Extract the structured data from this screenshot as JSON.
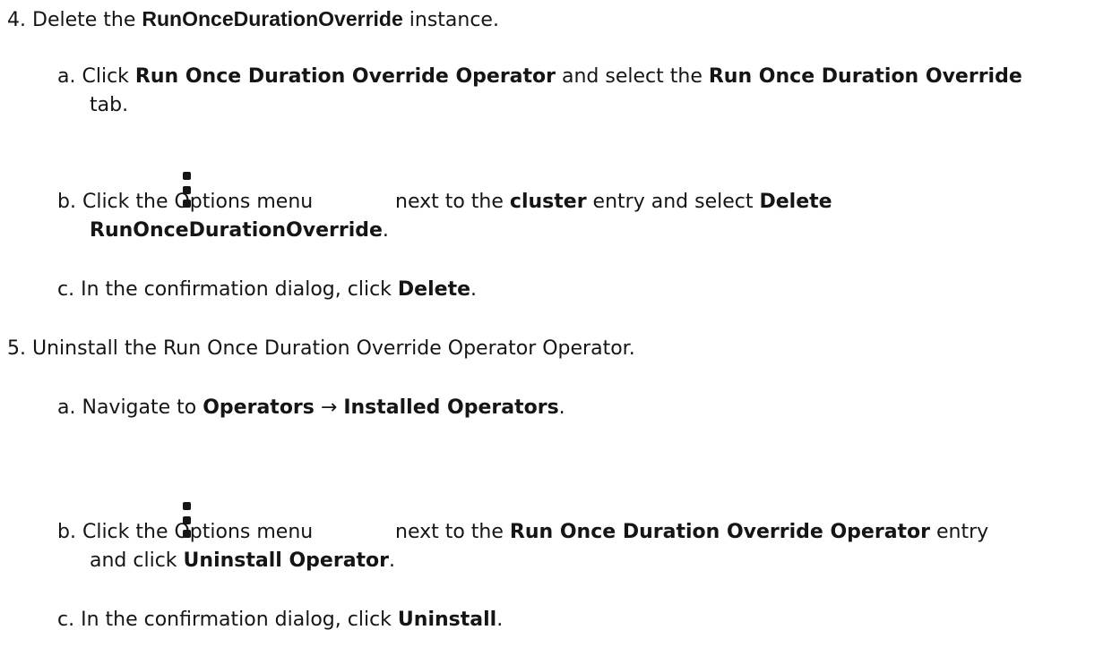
{
  "steps": [
    {
      "marker": "4.",
      "prefix": "Delete the ",
      "code": "RunOnceDurationOverride",
      "suffix": " instance.",
      "substeps": [
        {
          "marker": "a.",
          "l1_t1": "Click ",
          "l1_b1": "Run Once Duration Override Operator",
          "l1_t2": " and select the ",
          "l1_b2": "Run Once Duration Override",
          "l2_t1": "tab."
        },
        {
          "marker": "b.",
          "l1_t1": "Click the Options menu",
          "icon": "kebab-options-icon",
          "l1_t2": "next to the ",
          "l1_b1": "cluster",
          "l1_t3": " entry and select ",
          "l1_b2": "Delete",
          "l2_b1": "RunOnceDurationOverride",
          "l2_t1": "."
        },
        {
          "marker": "c.",
          "l1_t1": "In the confirmation dialog, click ",
          "l1_b1": "Delete",
          "l1_t2": "."
        }
      ]
    },
    {
      "marker": "5.",
      "text": "Uninstall the Run Once Duration Override Operator Operator.",
      "substeps": [
        {
          "marker": "a.",
          "l1_t1": "Navigate to ",
          "l1_b1": "Operators",
          "l1_t2": " → ",
          "l1_b2": "Installed Operators",
          "l1_t3": "."
        },
        {
          "marker": "b.",
          "l1_t1": "Click the Options menu",
          "icon": "kebab-options-icon",
          "l1_t2": "next to the ",
          "l1_b1": "Run Once Duration Override Operator",
          "l1_t3": " entry",
          "l2_t1": "and click ",
          "l2_b1": "Uninstall Operator",
          "l2_t2": "."
        },
        {
          "marker": "c.",
          "l1_t1": "In the confirmation dialog, click ",
          "l1_b1": "Uninstall",
          "l1_t2": "."
        }
      ]
    }
  ]
}
